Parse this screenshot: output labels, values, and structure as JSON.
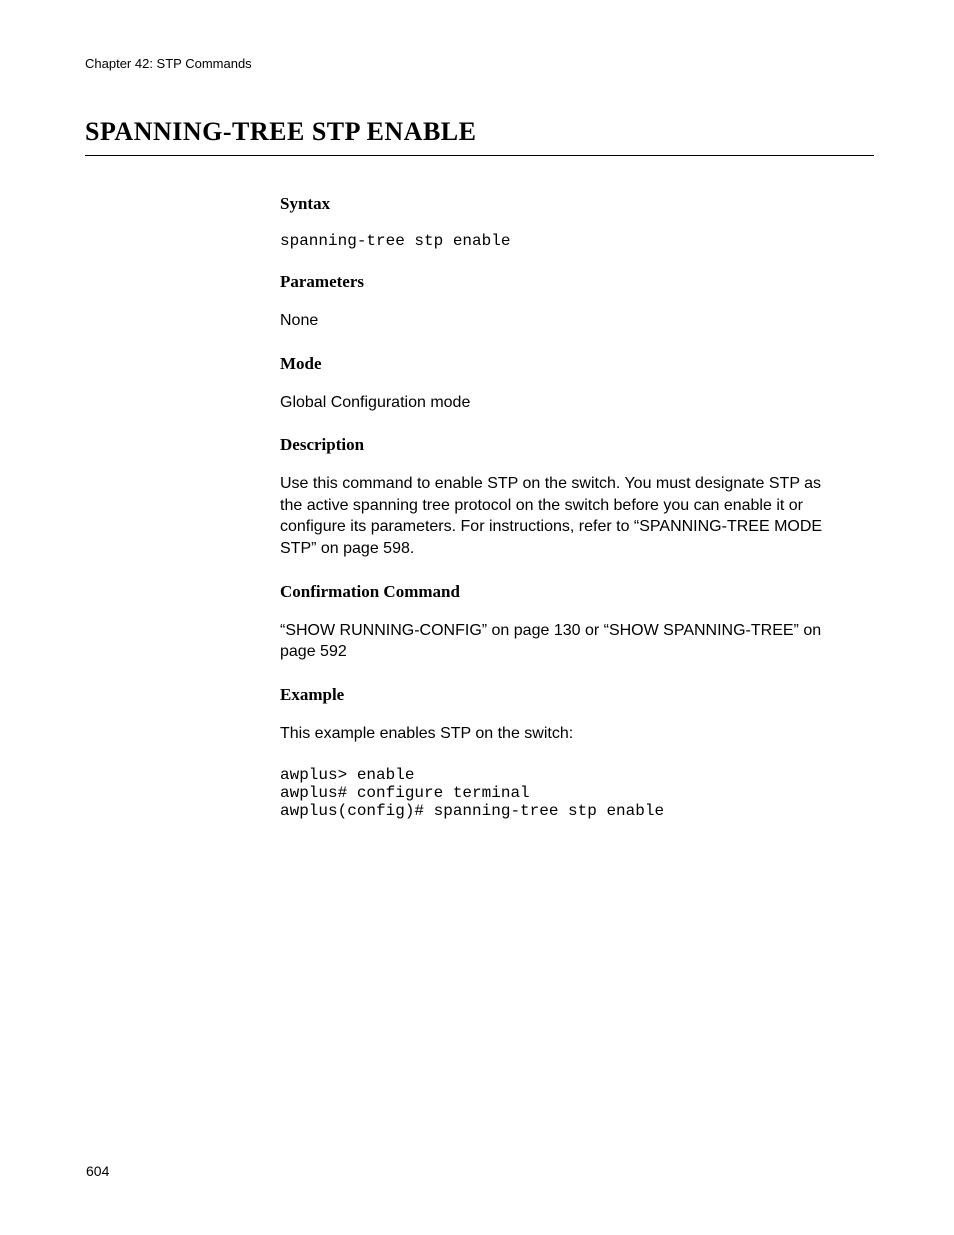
{
  "chapter_header": "Chapter 42: STP Commands",
  "main_title": "SPANNING-TREE STP ENABLE",
  "sections": {
    "syntax": {
      "heading": "Syntax",
      "content": "spanning-tree stp enable"
    },
    "parameters": {
      "heading": "Parameters",
      "content": "None"
    },
    "mode": {
      "heading": "Mode",
      "content": "Global Configuration mode"
    },
    "description": {
      "heading": "Description",
      "content": "Use this command to enable STP on the switch. You must designate STP as the active spanning tree protocol on the switch before you can enable it or configure its parameters. For instructions, refer to “SPANNING-TREE MODE STP” on page 598."
    },
    "confirmation": {
      "heading": "Confirmation Command",
      "content": "“SHOW RUNNING-CONFIG” on page 130 or “SHOW SPANNING-TREE” on page 592"
    },
    "example": {
      "heading": "Example",
      "intro": "This example enables STP on the switch:",
      "code": "awplus> enable\nawplus# configure terminal\nawplus(config)# spanning-tree stp enable"
    }
  },
  "page_number": "604"
}
